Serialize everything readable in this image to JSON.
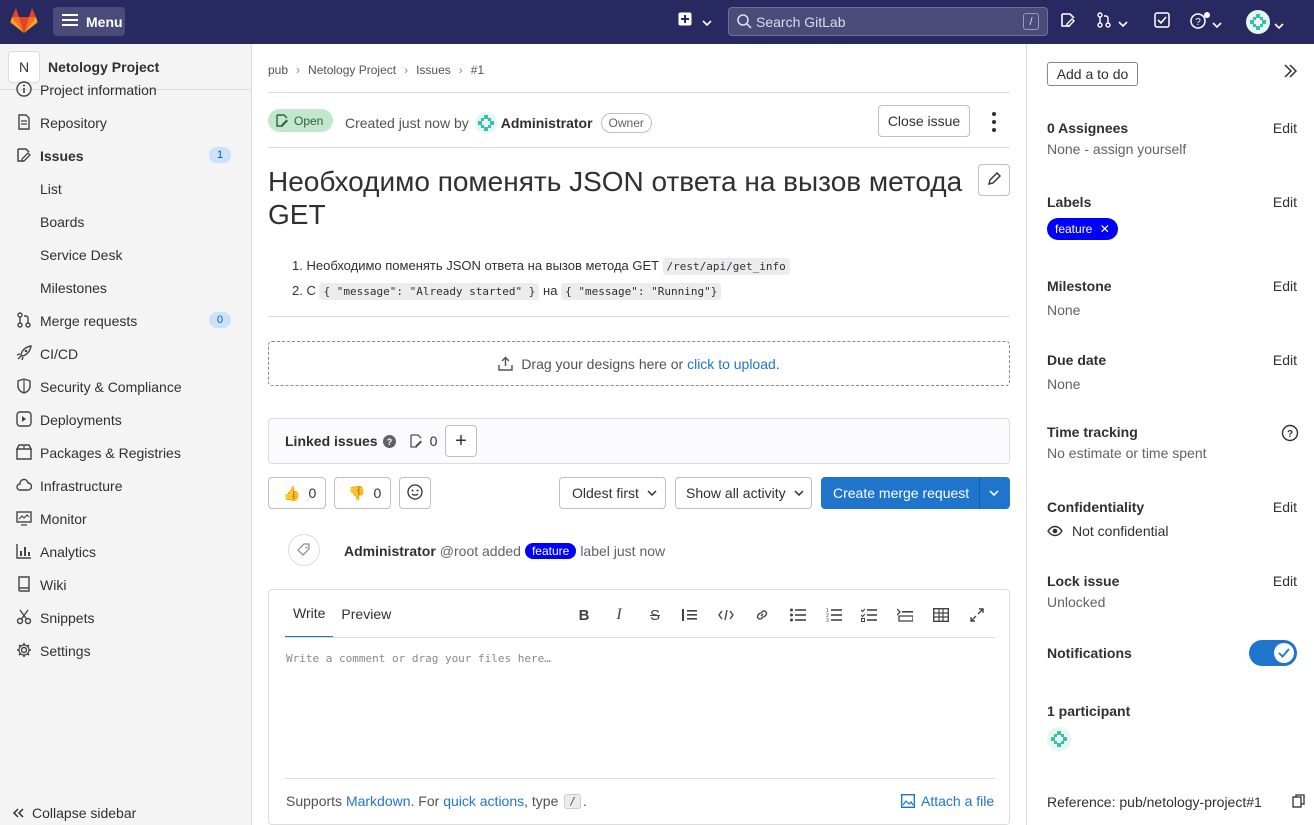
{
  "topbar": {
    "menu_label": "Menu",
    "search_placeholder": "Search GitLab",
    "search_shortcut": "/"
  },
  "sidebar": {
    "project_avatar": "N",
    "project_name": "Netology Project",
    "items": [
      {
        "label": "Project information",
        "icon": "info-icon"
      },
      {
        "label": "Repository",
        "icon": "doc-icon"
      },
      {
        "label": "Issues",
        "icon": "issues-icon",
        "count": "1"
      },
      {
        "label": "List",
        "sub": true
      },
      {
        "label": "Boards",
        "sub": true
      },
      {
        "label": "Service Desk",
        "sub": true
      },
      {
        "label": "Milestones",
        "sub": true
      },
      {
        "label": "Merge requests",
        "icon": "merge-request-icon",
        "count": "0"
      },
      {
        "label": "CI/CD",
        "icon": "rocket-icon"
      },
      {
        "label": "Security & Compliance",
        "icon": "shield-icon"
      },
      {
        "label": "Deployments",
        "icon": "deployments-icon"
      },
      {
        "label": "Packages & Registries",
        "icon": "package-icon"
      },
      {
        "label": "Infrastructure",
        "icon": "cloud-icon"
      },
      {
        "label": "Monitor",
        "icon": "monitor-icon"
      },
      {
        "label": "Analytics",
        "icon": "chart-icon"
      },
      {
        "label": "Wiki",
        "icon": "book-icon"
      },
      {
        "label": "Snippets",
        "icon": "scissors-icon"
      },
      {
        "label": "Settings",
        "icon": "gear-icon"
      }
    ],
    "collapse_label": "Collapse sidebar"
  },
  "breadcrumbs": [
    "pub",
    "Netology Project",
    "Issues",
    "#1"
  ],
  "issue": {
    "status": "Open",
    "created_text": "Created just now by",
    "author": "Administrator",
    "author_role": "Owner",
    "close_label": "Close issue",
    "title": "Необходимо поменять JSON ответа на вызов метода GET",
    "desc1_text": "Необходимо поменять JSON ответа на вызов метода GET",
    "desc1_code": "/rest/api/get_info",
    "desc2_prefix": "С",
    "desc2_code1": "{ \"message\": \"Already started\" }",
    "desc2_mid": "на",
    "desc2_code2": "{ \"message\": \"Running\"}",
    "drop_text": "Drag your designs here or",
    "drop_link": "click to upload",
    "drop_end": ".",
    "linked_label": "Linked issues",
    "linked_count": "0",
    "thumbs_up": "0",
    "thumbs_down": "0",
    "sort_label": "Oldest first",
    "filter_label": "Show all activity",
    "mr_label": "Create merge request",
    "note_author": "Administrator",
    "note_handle": "@root added",
    "note_label": "feature",
    "note_rest": "label just now"
  },
  "editor": {
    "tab_write": "Write",
    "tab_preview": "Preview",
    "placeholder": "Write a comment or drag your files here…",
    "footer_prefix": "Supports",
    "footer_markdown": "Markdown",
    "footer_mid": ". For",
    "footer_quick": "quick actions",
    "footer_type": ", type",
    "footer_slash": "/",
    "footer_end": ".",
    "attach": "Attach a file"
  },
  "right": {
    "todo": "Add a to do",
    "assignees_h": "0 Assignees",
    "assignees_v": "None - assign yourself",
    "labels_h": "Labels",
    "label_feature": "feature",
    "milestone_h": "Milestone",
    "milestone_v": "None",
    "due_h": "Due date",
    "due_v": "None",
    "time_h": "Time tracking",
    "time_v": "No estimate or time spent",
    "conf_h": "Confidentiality",
    "conf_v": "Not confidential",
    "lock_h": "Lock issue",
    "lock_v": "Unlocked",
    "notif_h": "Notifications",
    "notif_on": true,
    "part_h": "1 participant",
    "reference": "Reference: pub/netology-project#1",
    "edit": "Edit"
  },
  "colors": {
    "topbar": "#292961",
    "accent": "#1f75cb",
    "label": "#0000ff",
    "open_badge": "#c3e6cd"
  }
}
